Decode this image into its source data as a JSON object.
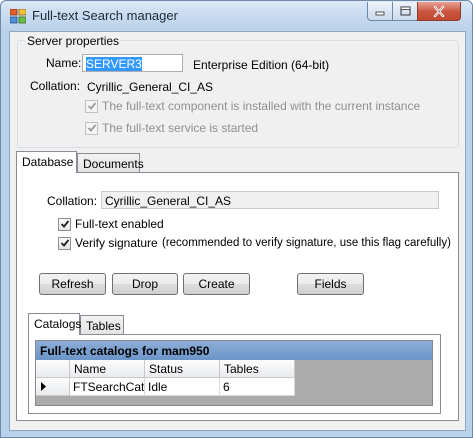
{
  "window": {
    "title": "Full-text Search manager"
  },
  "server_properties": {
    "legend": "Server properties",
    "name_label": "Name:",
    "name_value": "SERVER3",
    "edition": "Enterprise Edition (64-bit)",
    "collation_label": "Collation:",
    "collation_value": "Cyrillic_General_CI_AS",
    "component_installed_label": "The full-text component is installed  with the current instance",
    "component_installed_checked": true,
    "service_started_label": "The full-text service is started",
    "service_started_checked": true
  },
  "main_tabs": [
    {
      "label": "Database",
      "active": true
    },
    {
      "label": "Documents",
      "active": false
    }
  ],
  "database": {
    "collation_label": "Collation:",
    "collation_value": "Cyrillic_General_CI_AS",
    "fulltext_enabled_label": "Full-text enabled",
    "fulltext_enabled_checked": true,
    "verify_signature_label": "Verify signature",
    "verify_signature_checked": true,
    "verify_note": "(recommended to verify signature, use this flag carefully)"
  },
  "buttons": {
    "refresh": "Refresh",
    "drop": "Drop",
    "create": "Create",
    "fields": "Fields"
  },
  "sub_tabs": [
    {
      "label": "Catalogs",
      "active": true
    },
    {
      "label": "Tables",
      "active": false
    }
  ],
  "catalogs_grid": {
    "caption": "Full-text catalogs for mam950",
    "columns": [
      "Name",
      "Status",
      "Tables"
    ],
    "rows": [
      {
        "current": true,
        "cells": [
          "FTSearchCat",
          "Idle",
          "6"
        ]
      }
    ]
  },
  "colors": {
    "selection": "#3399ff",
    "grid_caption": "#7aa0cf",
    "window_frame": "#b9d1ea"
  },
  "icons": {
    "app": "app-grid-icon",
    "minimize": "minimize-icon",
    "maximize": "maximize-icon",
    "close": "close-icon",
    "checkmark": "checkmark-icon",
    "row_pointer": "row-pointer-icon"
  }
}
